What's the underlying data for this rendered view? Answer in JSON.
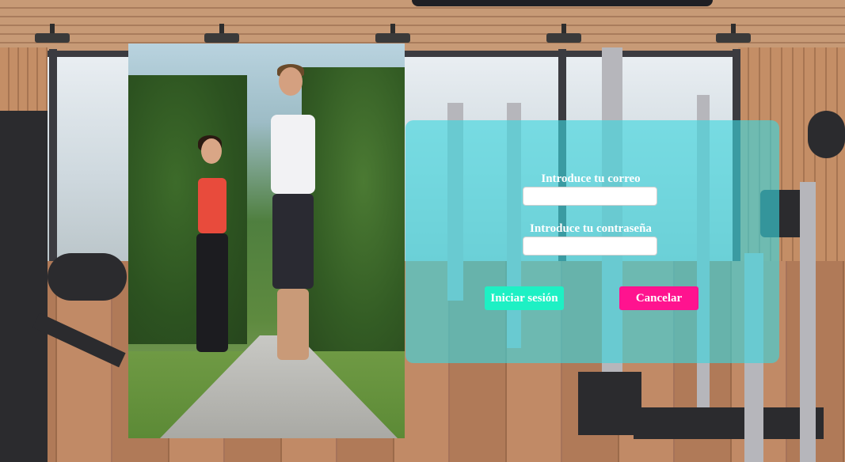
{
  "login": {
    "email_label": "Introduce tu correo",
    "email_value": "",
    "password_label": "Introduce tu contraseña",
    "password_value": "",
    "submit_label": "Iniciar sesión",
    "cancel_label": "Cancelar"
  },
  "colors": {
    "panel": "#3ad6de",
    "submit_button": "#1ef0c4",
    "cancel_button": "#ff138f"
  }
}
